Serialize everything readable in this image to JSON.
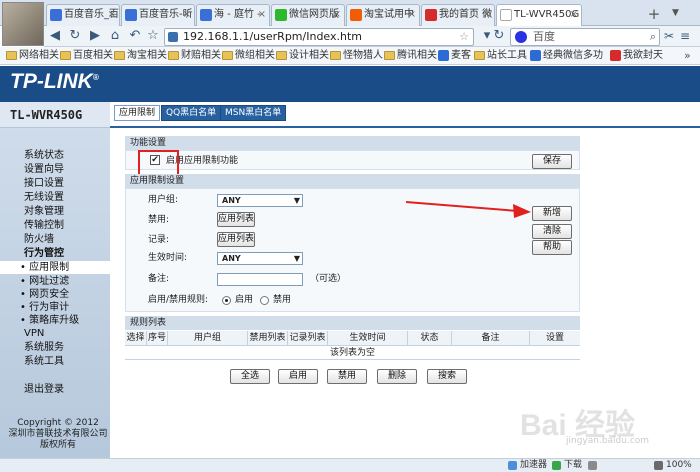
{
  "browser": {
    "tabs": [
      {
        "label": "百度音乐_百",
        "favicon": "#3a6fd8"
      },
      {
        "label": "百度音乐-听",
        "favicon": "#3a6fd8"
      },
      {
        "label": "海 - 庭竹 -",
        "favicon": "#3a6fd8"
      },
      {
        "label": "微信网页版",
        "favicon": "#2eb82e"
      },
      {
        "label": "淘宝试用中",
        "favicon": "#f25c05"
      },
      {
        "label": "我的首页 微",
        "favicon": "#d52b2b"
      },
      {
        "label": "TL-WVR450G",
        "favicon": "#ffffff"
      }
    ],
    "new_tab": "+",
    "url": "192.168.1.1/userRpm/Index.htm",
    "search_placeholder": "百度",
    "bookmarks": [
      {
        "label": "网络相关",
        "type": "folder"
      },
      {
        "label": "百度相关",
        "type": "folder"
      },
      {
        "label": "淘宝相关",
        "type": "folder"
      },
      {
        "label": "财赔相关",
        "type": "folder"
      },
      {
        "label": "微组相关",
        "type": "folder"
      },
      {
        "label": "设计相关",
        "type": "folder"
      },
      {
        "label": "怪物猎人",
        "type": "folder"
      },
      {
        "label": "腾讯相关",
        "type": "folder"
      },
      {
        "label": "麦客",
        "type": "link",
        "color": "#2c6bd6"
      },
      {
        "label": "站长工具",
        "type": "folder"
      },
      {
        "label": "经典微信多功",
        "type": "link",
        "color": "#2c6bd6"
      },
      {
        "label": "我欲封天",
        "type": "link",
        "color": "#d52b2b"
      }
    ],
    "bookmarks_more": "»"
  },
  "router": {
    "logo": "TP-LINK",
    "model": "TL-WVR450G",
    "page_tabs": [
      "应用限制",
      "QQ黑白名单",
      "MSN黑白名单"
    ],
    "sidebar": [
      {
        "label": "系统状态",
        "style": "normal"
      },
      {
        "label": "设置向导",
        "style": "normal"
      },
      {
        "label": "接口设置",
        "style": "normal"
      },
      {
        "label": "无线设置",
        "style": "normal"
      },
      {
        "label": "对象管理",
        "style": "normal"
      },
      {
        "label": "传输控制",
        "style": "normal"
      },
      {
        "label": "防火墙",
        "style": "normal"
      },
      {
        "label": "行为管控",
        "style": "bold"
      },
      {
        "label": "• 应用限制",
        "style": "current"
      },
      {
        "label": "• 网址过滤",
        "style": "sub"
      },
      {
        "label": "• 网页安全",
        "style": "sub"
      },
      {
        "label": "• 行为审计",
        "style": "sub"
      },
      {
        "label": "• 策略库升级",
        "style": "sub"
      },
      {
        "label": "VPN",
        "style": "normal"
      },
      {
        "label": "系统服务",
        "style": "normal"
      },
      {
        "label": "系统工具",
        "style": "normal"
      }
    ],
    "logout": "退出登录",
    "copyright": [
      "Copyright © 2012",
      "深圳市普联技术有限公司",
      "版权所有"
    ],
    "func_section": {
      "title": "功能设置",
      "enable_label": "启用应用限制功能",
      "enable_checked": "✔",
      "save": "保存"
    },
    "rule_section": {
      "title": "应用限制设置",
      "user_group_label": "用户组:",
      "user_group_value": "ANY",
      "block_label": "禁用:",
      "block_btn": "应用列表",
      "record_label": "记录:",
      "record_btn": "应用列表",
      "time_label": "生效时间:",
      "time_value": "ANY",
      "note_label": "备注:",
      "note_value": "",
      "optional": "（可选）",
      "rule_label": "启用/禁用规则:",
      "enable_opt": "启用",
      "disable_opt": "禁用",
      "buttons": {
        "add": "新增",
        "clear": "清除",
        "help": "帮助"
      }
    },
    "rule_list": {
      "title": "规则列表",
      "columns": [
        "选择",
        "序号",
        "用户组",
        "禁用列表",
        "记录列表",
        "生效时间",
        "状态",
        "备注",
        "设置"
      ],
      "empty_text": "该列表为空",
      "actions": [
        "全选",
        "启用",
        "禁用",
        "删除",
        "搜索"
      ]
    }
  },
  "statusbar": {
    "items": [
      "加速器",
      "下载",
      "",
      "100%"
    ]
  },
  "watermark": {
    "text": "Bai 经验",
    "sub": "jingyan.baidu.com"
  },
  "colors": {
    "annotation_red": "#e12020",
    "banner_blue": "#1a4d87"
  }
}
